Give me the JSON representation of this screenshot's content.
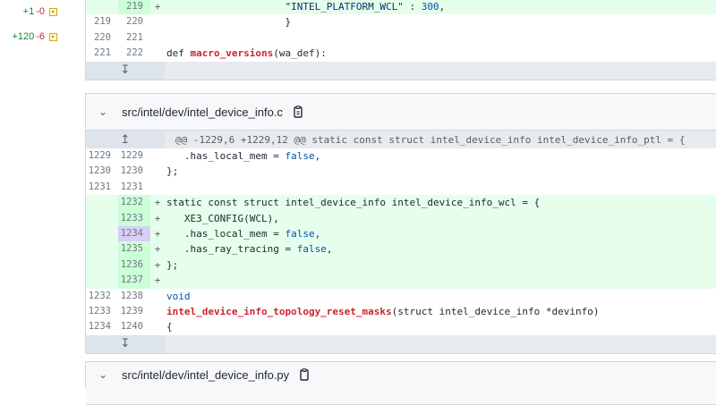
{
  "file_tree_stats": [
    {
      "additions": "+1",
      "deletions": "-0"
    },
    {
      "additions": "+120",
      "deletions": "-6"
    }
  ],
  "diff1": {
    "rows": [
      {
        "old": "",
        "new": "219",
        "marker": "+",
        "type": "add",
        "parts": [
          {
            "t": "                    ",
            "c": ""
          },
          {
            "t": "\"INTEL_PLATFORM_WCL\"",
            "c": "str"
          },
          {
            "t": " : ",
            "c": ""
          },
          {
            "t": "300",
            "c": "num"
          },
          {
            "t": ",",
            "c": ""
          }
        ]
      },
      {
        "old": "219",
        "new": "220",
        "marker": "",
        "type": "ctx",
        "parts": [
          {
            "t": "                    }",
            "c": ""
          }
        ]
      },
      {
        "old": "220",
        "new": "221",
        "marker": "",
        "type": "ctx",
        "parts": [
          {
            "t": "",
            "c": ""
          }
        ]
      },
      {
        "old": "221",
        "new": "222",
        "marker": "",
        "type": "ctx",
        "parts": [
          {
            "t": "def ",
            "c": ""
          },
          {
            "t": "macro_versions",
            "c": "fn-red"
          },
          {
            "t": "(wa_def):",
            "c": ""
          }
        ]
      }
    ],
    "expand_icon": "expand-down-icon"
  },
  "diff2": {
    "filename": "src/intel/dev/intel_device_info.c",
    "hunk_header": "@@ -1229,6 +1229,12 @@ static const struct intel_device_info intel_device_info_ptl = {",
    "rows": [
      {
        "old": "1229",
        "new": "1229",
        "marker": "",
        "type": "ctx",
        "parts": [
          {
            "t": "   .has_local_mem = ",
            "c": ""
          },
          {
            "t": "false",
            "c": "bool"
          },
          {
            "t": ",",
            "c": ""
          }
        ]
      },
      {
        "old": "1230",
        "new": "1230",
        "marker": "",
        "type": "ctx",
        "parts": [
          {
            "t": "};",
            "c": ""
          }
        ]
      },
      {
        "old": "1231",
        "new": "1231",
        "marker": "",
        "type": "ctx",
        "parts": [
          {
            "t": "",
            "c": ""
          }
        ]
      },
      {
        "old": "",
        "new": "1232",
        "marker": "+",
        "type": "add",
        "parts": [
          {
            "t": "static const struct intel_device_info intel_device_info_wcl = {",
            "c": ""
          }
        ]
      },
      {
        "old": "",
        "new": "1233",
        "marker": "+",
        "type": "add",
        "parts": [
          {
            "t": "   XE3_CONFIG(WCL),",
            "c": ""
          }
        ]
      },
      {
        "old": "",
        "new": "1234",
        "marker": "+",
        "type": "add",
        "selected": true,
        "parts": [
          {
            "t": "   .has_local_mem = ",
            "c": ""
          },
          {
            "t": "false",
            "c": "bool"
          },
          {
            "t": ",",
            "c": ""
          }
        ]
      },
      {
        "old": "",
        "new": "1235",
        "marker": "+",
        "type": "add",
        "parts": [
          {
            "t": "   .has_ray_tracing = ",
            "c": ""
          },
          {
            "t": "false",
            "c": "bool"
          },
          {
            "t": ",",
            "c": ""
          }
        ]
      },
      {
        "old": "",
        "new": "1236",
        "marker": "+",
        "type": "add",
        "parts": [
          {
            "t": "};",
            "c": ""
          }
        ]
      },
      {
        "old": "",
        "new": "1237",
        "marker": "+",
        "type": "add",
        "parts": [
          {
            "t": "",
            "c": ""
          }
        ]
      },
      {
        "old": "1232",
        "new": "1238",
        "marker": "",
        "type": "ctx",
        "parts": [
          {
            "t": "void",
            "c": "const"
          }
        ]
      },
      {
        "old": "1233",
        "new": "1239",
        "marker": "",
        "type": "ctx",
        "parts": [
          {
            "t": "intel_device_info_topology_reset_masks",
            "c": "fn-red"
          },
          {
            "t": "(struct intel_device_info *devinfo)",
            "c": ""
          }
        ]
      },
      {
        "old": "1234",
        "new": "1240",
        "marker": "",
        "type": "ctx",
        "parts": [
          {
            "t": "{",
            "c": ""
          }
        ]
      }
    ]
  },
  "diff3": {
    "filename": "src/intel/dev/intel_device_info.py"
  },
  "icons": {
    "expand_up": "↥",
    "expand_down": "↧",
    "chevron": "⌄"
  }
}
